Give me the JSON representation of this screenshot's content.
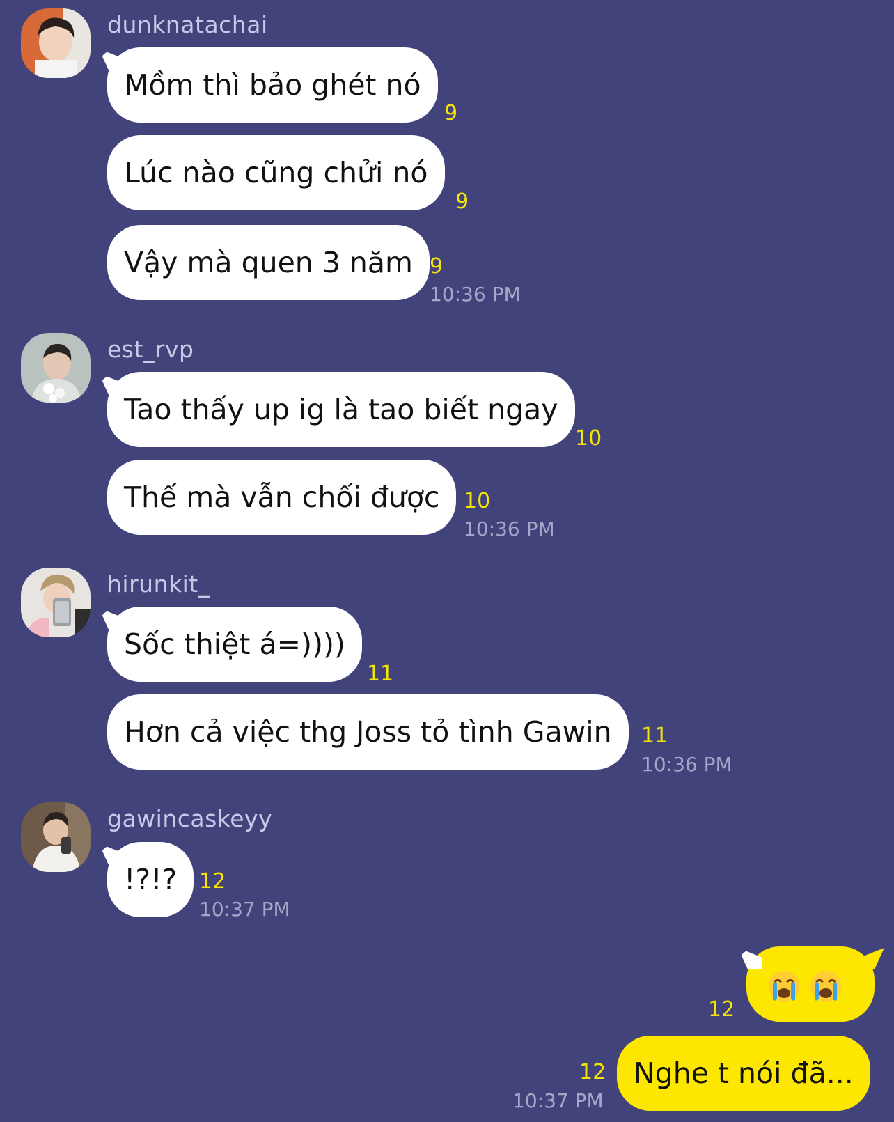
{
  "messages": {
    "group1": {
      "sender": "dunknatachai",
      "bubbles": [
        {
          "text": "Mồm thì bảo ghét nó",
          "read": "9"
        },
        {
          "text": "Lúc nào cũng chửi nó",
          "read": "9"
        },
        {
          "text": "Vậy mà quen 3 năm",
          "read": "9"
        }
      ],
      "time": "10:36 PM"
    },
    "group2": {
      "sender": "est_rvp",
      "bubbles": [
        {
          "text": "Tao thấy up ig là tao biết ngay",
          "read": "10"
        },
        {
          "text": "Thế mà vẫn chối được",
          "read": "10"
        }
      ],
      "time": "10:36 PM"
    },
    "group3": {
      "sender": "hirunkit_",
      "bubbles": [
        {
          "text": "Sốc thiệt á=))))",
          "read": "11"
        },
        {
          "text": "Hơn cả việc thg Joss tỏ tình Gawin",
          "read": "11"
        }
      ],
      "time": "10:36 PM"
    },
    "group4": {
      "sender": "gawincaskeyy",
      "bubbles": [
        {
          "text": "!?!?",
          "read": "12"
        }
      ],
      "time": "10:37 PM"
    },
    "outgoing": {
      "bubbles": [
        {
          "emoji": [
            "loudly-crying-face",
            "loudly-crying-face"
          ],
          "read": "12"
        },
        {
          "text": "Nghe t nói đã...",
          "read": "12"
        }
      ],
      "time": "10:37 PM"
    }
  },
  "colors": {
    "background": "#42437a",
    "incoming_bubble": "#ffffff",
    "outgoing_bubble": "#fde600",
    "read_count": "#f5e500",
    "timestamp": "#a7a6c9",
    "sender_name": "#c9c8e6"
  }
}
